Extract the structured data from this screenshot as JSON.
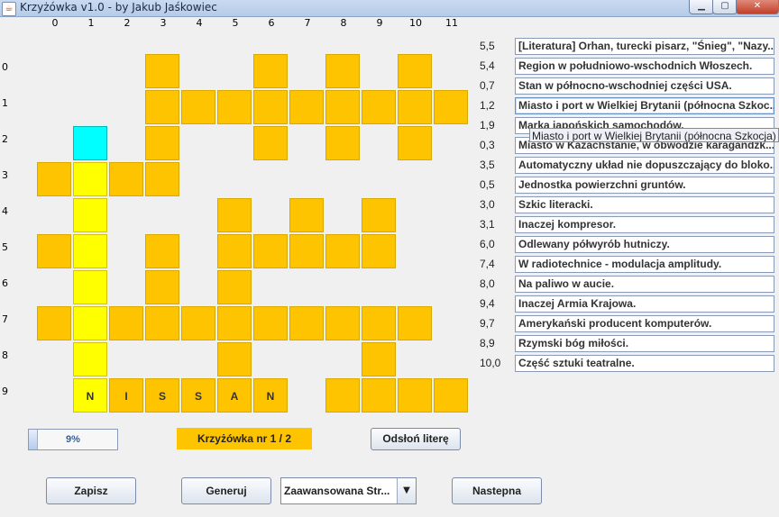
{
  "window": {
    "title": "Krzyżówka v1.0 - by Jakub Jaśkowiec",
    "app_icon": "java-icon"
  },
  "grid": {
    "columns": [
      "0",
      "1",
      "2",
      "3",
      "4",
      "5",
      "6",
      "7",
      "8",
      "9",
      "10",
      "11"
    ],
    "rows": [
      "0",
      "1",
      "2",
      "3",
      "4",
      "5",
      "6",
      "7",
      "8",
      "9"
    ],
    "cells": [
      {
        "r": 0,
        "c": 3,
        "s": "o"
      },
      {
        "r": 0,
        "c": 6,
        "s": "o"
      },
      {
        "r": 0,
        "c": 8,
        "s": "o"
      },
      {
        "r": 0,
        "c": 10,
        "s": "o"
      },
      {
        "r": 1,
        "c": 3,
        "s": "o"
      },
      {
        "r": 1,
        "c": 4,
        "s": "o"
      },
      {
        "r": 1,
        "c": 5,
        "s": "o"
      },
      {
        "r": 1,
        "c": 6,
        "s": "o"
      },
      {
        "r": 1,
        "c": 7,
        "s": "o"
      },
      {
        "r": 1,
        "c": 8,
        "s": "o"
      },
      {
        "r": 1,
        "c": 9,
        "s": "o"
      },
      {
        "r": 1,
        "c": 10,
        "s": "o"
      },
      {
        "r": 1,
        "c": 11,
        "s": "o"
      },
      {
        "r": 2,
        "c": 1,
        "s": "c"
      },
      {
        "r": 2,
        "c": 3,
        "s": "o"
      },
      {
        "r": 2,
        "c": 6,
        "s": "o"
      },
      {
        "r": 2,
        "c": 8,
        "s": "o"
      },
      {
        "r": 2,
        "c": 10,
        "s": "o"
      },
      {
        "r": 3,
        "c": 0,
        "s": "o"
      },
      {
        "r": 3,
        "c": 1,
        "s": "y"
      },
      {
        "r": 3,
        "c": 2,
        "s": "o"
      },
      {
        "r": 3,
        "c": 3,
        "s": "o"
      },
      {
        "r": 4,
        "c": 1,
        "s": "y"
      },
      {
        "r": 4,
        "c": 5,
        "s": "o"
      },
      {
        "r": 4,
        "c": 7,
        "s": "o"
      },
      {
        "r": 4,
        "c": 9,
        "s": "o"
      },
      {
        "r": 5,
        "c": 0,
        "s": "o"
      },
      {
        "r": 5,
        "c": 1,
        "s": "y"
      },
      {
        "r": 5,
        "c": 3,
        "s": "o"
      },
      {
        "r": 5,
        "c": 5,
        "s": "o"
      },
      {
        "r": 5,
        "c": 6,
        "s": "o"
      },
      {
        "r": 5,
        "c": 7,
        "s": "o"
      },
      {
        "r": 5,
        "c": 8,
        "s": "o"
      },
      {
        "r": 5,
        "c": 9,
        "s": "o"
      },
      {
        "r": 6,
        "c": 1,
        "s": "y"
      },
      {
        "r": 6,
        "c": 3,
        "s": "o"
      },
      {
        "r": 6,
        "c": 5,
        "s": "o"
      },
      {
        "r": 7,
        "c": 0,
        "s": "o"
      },
      {
        "r": 7,
        "c": 1,
        "s": "y"
      },
      {
        "r": 7,
        "c": 2,
        "s": "o"
      },
      {
        "r": 7,
        "c": 3,
        "s": "o"
      },
      {
        "r": 7,
        "c": 4,
        "s": "o"
      },
      {
        "r": 7,
        "c": 5,
        "s": "o"
      },
      {
        "r": 7,
        "c": 6,
        "s": "o"
      },
      {
        "r": 7,
        "c": 7,
        "s": "o"
      },
      {
        "r": 7,
        "c": 8,
        "s": "o"
      },
      {
        "r": 7,
        "c": 9,
        "s": "o"
      },
      {
        "r": 7,
        "c": 10,
        "s": "o"
      },
      {
        "r": 8,
        "c": 1,
        "s": "y"
      },
      {
        "r": 8,
        "c": 5,
        "s": "o"
      },
      {
        "r": 8,
        "c": 9,
        "s": "o"
      },
      {
        "r": 9,
        "c": 1,
        "s": "y",
        "t": "N"
      },
      {
        "r": 9,
        "c": 2,
        "s": "o",
        "t": "I"
      },
      {
        "r": 9,
        "c": 3,
        "s": "o",
        "t": "S"
      },
      {
        "r": 9,
        "c": 4,
        "s": "o",
        "t": "S"
      },
      {
        "r": 9,
        "c": 5,
        "s": "o",
        "t": "A"
      },
      {
        "r": 9,
        "c": 6,
        "s": "o",
        "t": "N"
      },
      {
        "r": 9,
        "c": 8,
        "s": "o"
      },
      {
        "r": 9,
        "c": 9,
        "s": "o"
      },
      {
        "r": 9,
        "c": 10,
        "s": "o"
      },
      {
        "r": 9,
        "c": 11,
        "s": "o"
      }
    ]
  },
  "clues": [
    {
      "pos": "5,5",
      "text": "[Literatura] Orhan, turecki pisarz, \"Śnieg\", \"Nazy..."
    },
    {
      "pos": "5,4",
      "text": "Region w południowo-wschodnich Włoszech."
    },
    {
      "pos": "0,7",
      "text": "Stan w północno-wschodniej części USA."
    },
    {
      "pos": "1,2",
      "text": "Miasto i port w Wielkiej Brytanii (północna Szkoc..."
    },
    {
      "pos": "1,9",
      "text": "Marka japońskich samochodów."
    },
    {
      "pos": "0,3",
      "text": "Miasto w Kazachstanie, w obwodzie karagandzk..."
    },
    {
      "pos": "3,5",
      "text": "Automatyczny układ nie dopuszczający do bloko..."
    },
    {
      "pos": "0,5",
      "text": "Jednostka powierzchni gruntów."
    },
    {
      "pos": "3,0",
      "text": "Szkic literacki."
    },
    {
      "pos": "3,1",
      "text": "Inaczej kompresor."
    },
    {
      "pos": "6,0",
      "text": "Odlewany półwyrób hutniczy."
    },
    {
      "pos": "7,4",
      "text": "W radiotechnice - modulacja amplitudy."
    },
    {
      "pos": "8,0",
      "text": "Na paliwo w aucie."
    },
    {
      "pos": "9,4",
      "text": "Inaczej Armia Krajowa."
    },
    {
      "pos": "9,7",
      "text": "Amerykański producent komputerów."
    },
    {
      "pos": "8,9",
      "text": "Rzymski bóg miłości."
    },
    {
      "pos": "10,0",
      "text": "Część sztuki teatralne."
    }
  ],
  "active_clue_index": 3,
  "tooltip": "Miasto i port w Wielkiej Brytanii (północna Szkocja)",
  "progress": {
    "label": "9%",
    "value": 9
  },
  "crossword_label": "Krzyżówka nr 1 / 2",
  "buttons": {
    "reveal": "Odsłoń literę",
    "save": "Zapisz",
    "generate": "Generuj",
    "next": "Nastepna"
  },
  "difficulty": {
    "selected": "Zaawansowana Str..."
  },
  "colors": {
    "orange": "#ffc400",
    "yellow": "#ffff00",
    "cyan": "#00ffff"
  }
}
